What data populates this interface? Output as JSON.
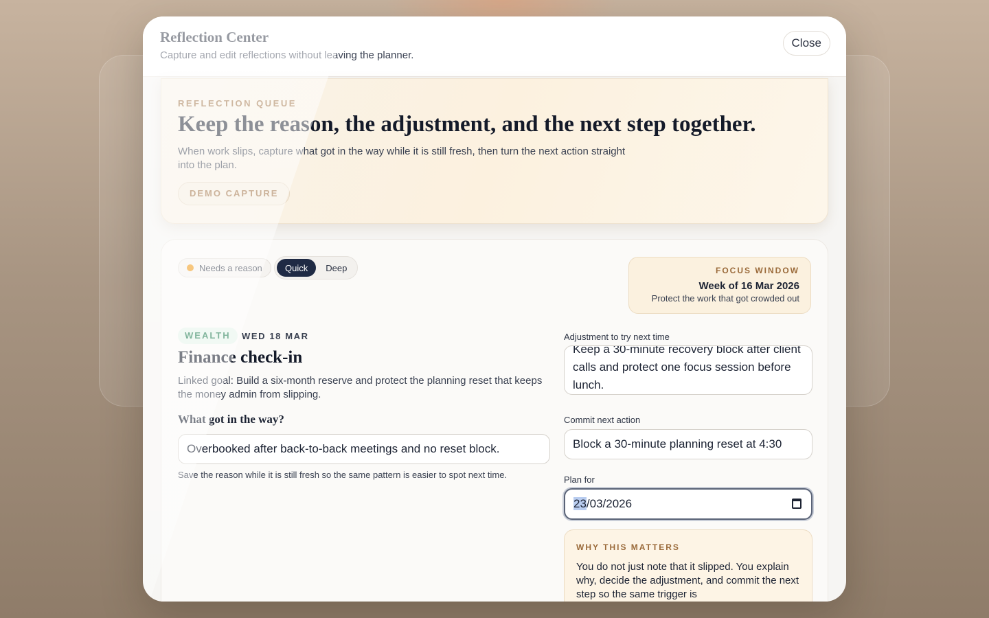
{
  "modal": {
    "title": "Reflection Center",
    "subtitle": "Capture and edit reflections without leaving the planner.",
    "close_label": "Close"
  },
  "hero": {
    "eyebrow": "REFLECTION QUEUE",
    "title": "Keep the reason, the adjustment, and the next step together.",
    "description": "When work slips, capture what got in the way while it is still fresh, then turn the next action straight into the plan.",
    "demo_label": "DEMO CAPTURE"
  },
  "status": {
    "label": "Needs a reason",
    "color": "#f0950c"
  },
  "mode": {
    "options": [
      "Quick",
      "Deep"
    ],
    "selected": "Quick"
  },
  "focus_window": {
    "eyebrow": "FOCUS WINDOW",
    "week": "Week of 16 Mar 2026",
    "note": "Protect the work that got crowded out"
  },
  "task": {
    "category": "WEALTH",
    "date": "WED 18 MAR",
    "title": "Finance check-in",
    "linked_goal": "Linked goal: Build a six-month reserve and protect the planning reset that keeps the money admin from slipping."
  },
  "reason": {
    "question": "What got in the way?",
    "value": "Overbooked after back-to-back meetings and no reset block.",
    "hint": "Save the reason while it is still fresh so the same pattern is easier to spot next time."
  },
  "adjustment": {
    "label": "Adjustment to try next time",
    "value": "Keep a 30-minute recovery block after client calls and protect one focus session before lunch."
  },
  "commit": {
    "label": "Commit next action",
    "value": "Block a 30-minute planning reset at 4:30"
  },
  "plan_for": {
    "label": "Plan for",
    "day": "23",
    "rest": "/03/2026"
  },
  "why": {
    "eyebrow": "WHY THIS MATTERS",
    "text": "You do not just note that it slipped. You explain why, decide the adjustment, and commit the next step so the same trigger is"
  }
}
